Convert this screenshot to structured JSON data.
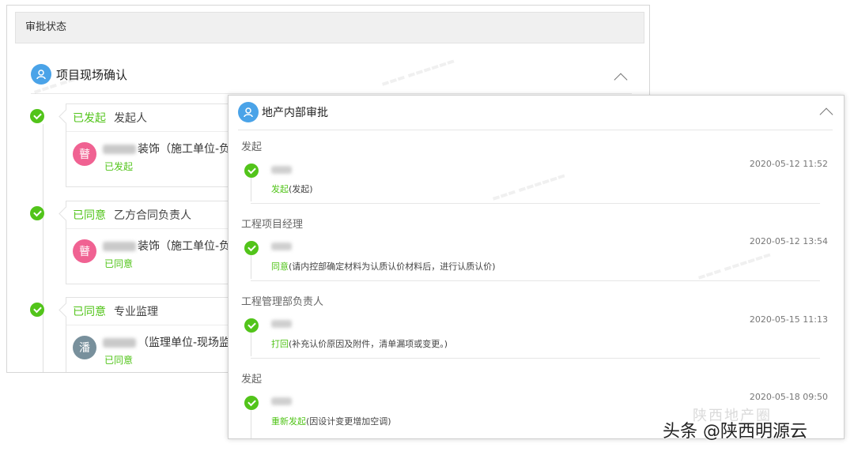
{
  "left": {
    "header": "审批状态",
    "section_title": "项目现场确认",
    "items": [
      {
        "status": "已发起",
        "role": "发起人",
        "avatar": "瞽",
        "avatar_color": "#f06292",
        "person": "装饰（施工单位-负责人",
        "small_status": "已发起"
      },
      {
        "status": "已同意",
        "role": "乙方合同负责人",
        "avatar": "瞽",
        "avatar_color": "#f06292",
        "person": "装饰（施工单位-负责人",
        "small_status": "已同意"
      },
      {
        "status": "已同意",
        "role": "专业监理",
        "avatar": "潘",
        "avatar_color": "#78909c",
        "person": "（监理单位-现场监理",
        "small_status": "已同意"
      }
    ]
  },
  "right": {
    "section_title": "地产内部审批",
    "groups": [
      {
        "label": "发起",
        "time": "2020-05-12 11:52",
        "action_link": "发起",
        "action_text": "(发起)"
      },
      {
        "label": "工程项目经理",
        "time": "2020-05-12 13:54",
        "action_link": "同意",
        "action_text": "(请内控部确定材料为认质认价材料后，进行认质认价)"
      },
      {
        "label": "工程管理部负责人",
        "time": "2020-05-15 11:13",
        "action_link": "打回",
        "action_text": "(补充认价原因及附件，清单漏项或变更。)"
      },
      {
        "label": "发起",
        "time": "2020-05-18 09:50",
        "action_link": "重新发起",
        "action_text": "(因设计变更增加空调)"
      }
    ]
  },
  "colors": {
    "accent_blue": "#4aa3e8",
    "success_green": "#52c41a",
    "reject_red": "#e57373"
  },
  "brand": {
    "faded": "陕西地产圈",
    "text": "头条 @陕西明源云"
  }
}
